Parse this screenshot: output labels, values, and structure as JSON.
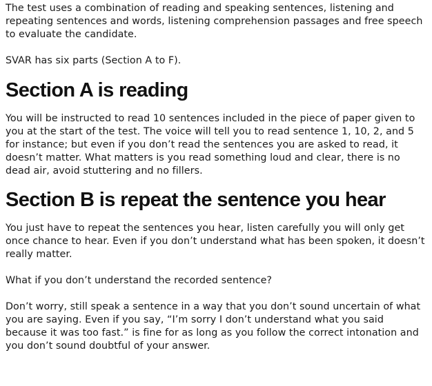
{
  "article": {
    "intro": "The test uses a combination of reading and speaking sentences, listening and repeating sentences and words, listening comprehension passages and free speech to evaluate the candidate.",
    "parts": "SVAR has six parts (Section A to F).",
    "section_a": {
      "heading": "Section A is reading",
      "body": "You will be instructed to read 10 sentences included in the piece of paper given to you at the start of the test. The voice will tell you to read sentence 1, 10, 2, and 5 for instance; but even if you don’t read the sentences you are asked to read, it doesn’t matter. What matters is you read something loud and clear, there is no dead air, avoid stuttering and no fillers."
    },
    "section_b": {
      "heading": "Section B is repeat the sentence you hear",
      "body": "You just have to repeat the sentences you hear, listen carefully you will only get once chance to hear. Even if you don’t understand what has been spoken, it doesn’t really matter.",
      "question": "What if you don’t understand the recorded sentence?",
      "answer": "Don’t worry, still speak a sentence in a way that you don’t sound uncertain of what you are saying. Even if you say, “I’m sorry I don’t understand what you said because it was too fast.” is fine for as long as you follow the correct intonation and you don’t sound doubtful of your answer."
    }
  }
}
